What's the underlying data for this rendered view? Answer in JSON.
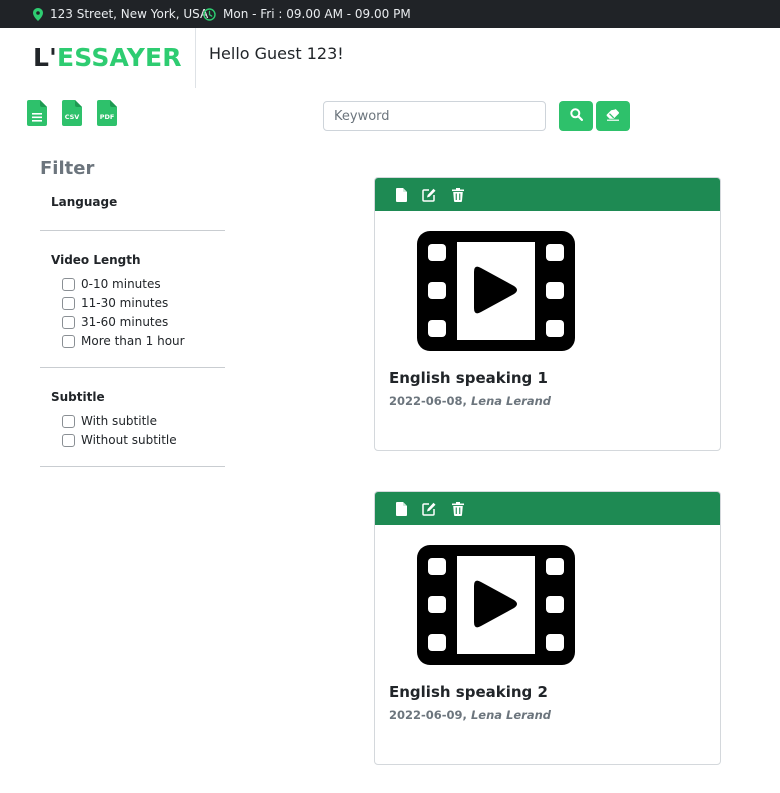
{
  "topbar": {
    "address": "123 Street, New York, USA",
    "hours": "Mon - Fri : 09.00 AM - 09.00 PM",
    "icon_color": "#2ecc71"
  },
  "header": {
    "logo_prefix": "L'",
    "logo_main": "ESSAYER",
    "greeting": "Hello Guest 123!"
  },
  "toolbar": {
    "file_icons": [
      {
        "label": "",
        "icon": "document-lines-icon"
      },
      {
        "label": "CSV",
        "icon": "csv-file-icon"
      },
      {
        "label": "PDF",
        "icon": "pdf-file-icon"
      }
    ],
    "search_placeholder": "Keyword",
    "search_value": "",
    "accent": "#2ec16b"
  },
  "filter": {
    "title": "Filter",
    "language": {
      "heading": "Language"
    },
    "video_length": {
      "heading": "Video Length",
      "options": [
        "0-10 minutes",
        "11-30 minutes",
        "31-60 minutes",
        "More than 1 hour"
      ]
    },
    "subtitle": {
      "heading": "Subtitle",
      "options": [
        "With subtitle",
        "Without subtitle"
      ]
    }
  },
  "cards": [
    {
      "title": "English speaking 1",
      "date": "2022-06-08, ",
      "author": "Lena Lerand"
    },
    {
      "title": "English speaking 2",
      "date": "2022-06-09, ",
      "author": "Lena Lerand"
    }
  ],
  "card_header_color": "#1e8a53"
}
